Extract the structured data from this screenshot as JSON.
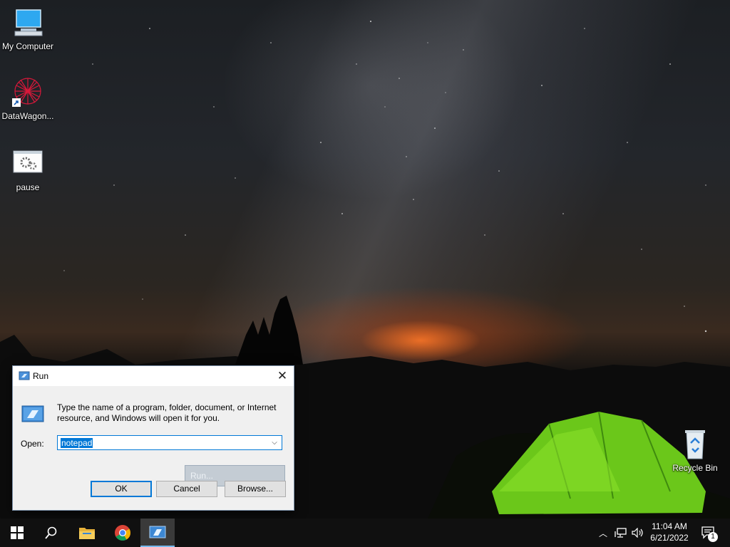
{
  "desktop": {
    "icons": [
      {
        "label": "My Computer",
        "icon": "computer-icon"
      },
      {
        "label": "DataWagon...",
        "icon": "datawagon-shortcut-icon"
      },
      {
        "label": "pause",
        "icon": "batch-file-icon"
      },
      {
        "label": "Recycle Bin",
        "icon": "recycle-bin-icon"
      }
    ]
  },
  "run_dialog": {
    "title": "Run",
    "instructions": "Type the name of a program, folder, document, or Internet resource, and Windows will open it for you.",
    "open_label": "Open:",
    "open_value": "notepad",
    "ok_label": "OK",
    "cancel_label": "Cancel",
    "browse_label": "Browse...",
    "drag_ghost_label": "Run..."
  },
  "taskbar": {
    "items": [
      "start-icon",
      "search-icon",
      "file-explorer-icon",
      "chrome-icon",
      "run-icon"
    ],
    "clock_time": "11:04 AM",
    "clock_date": "6/21/2022",
    "notification_count": "1",
    "accent_color": "#0078d7"
  }
}
